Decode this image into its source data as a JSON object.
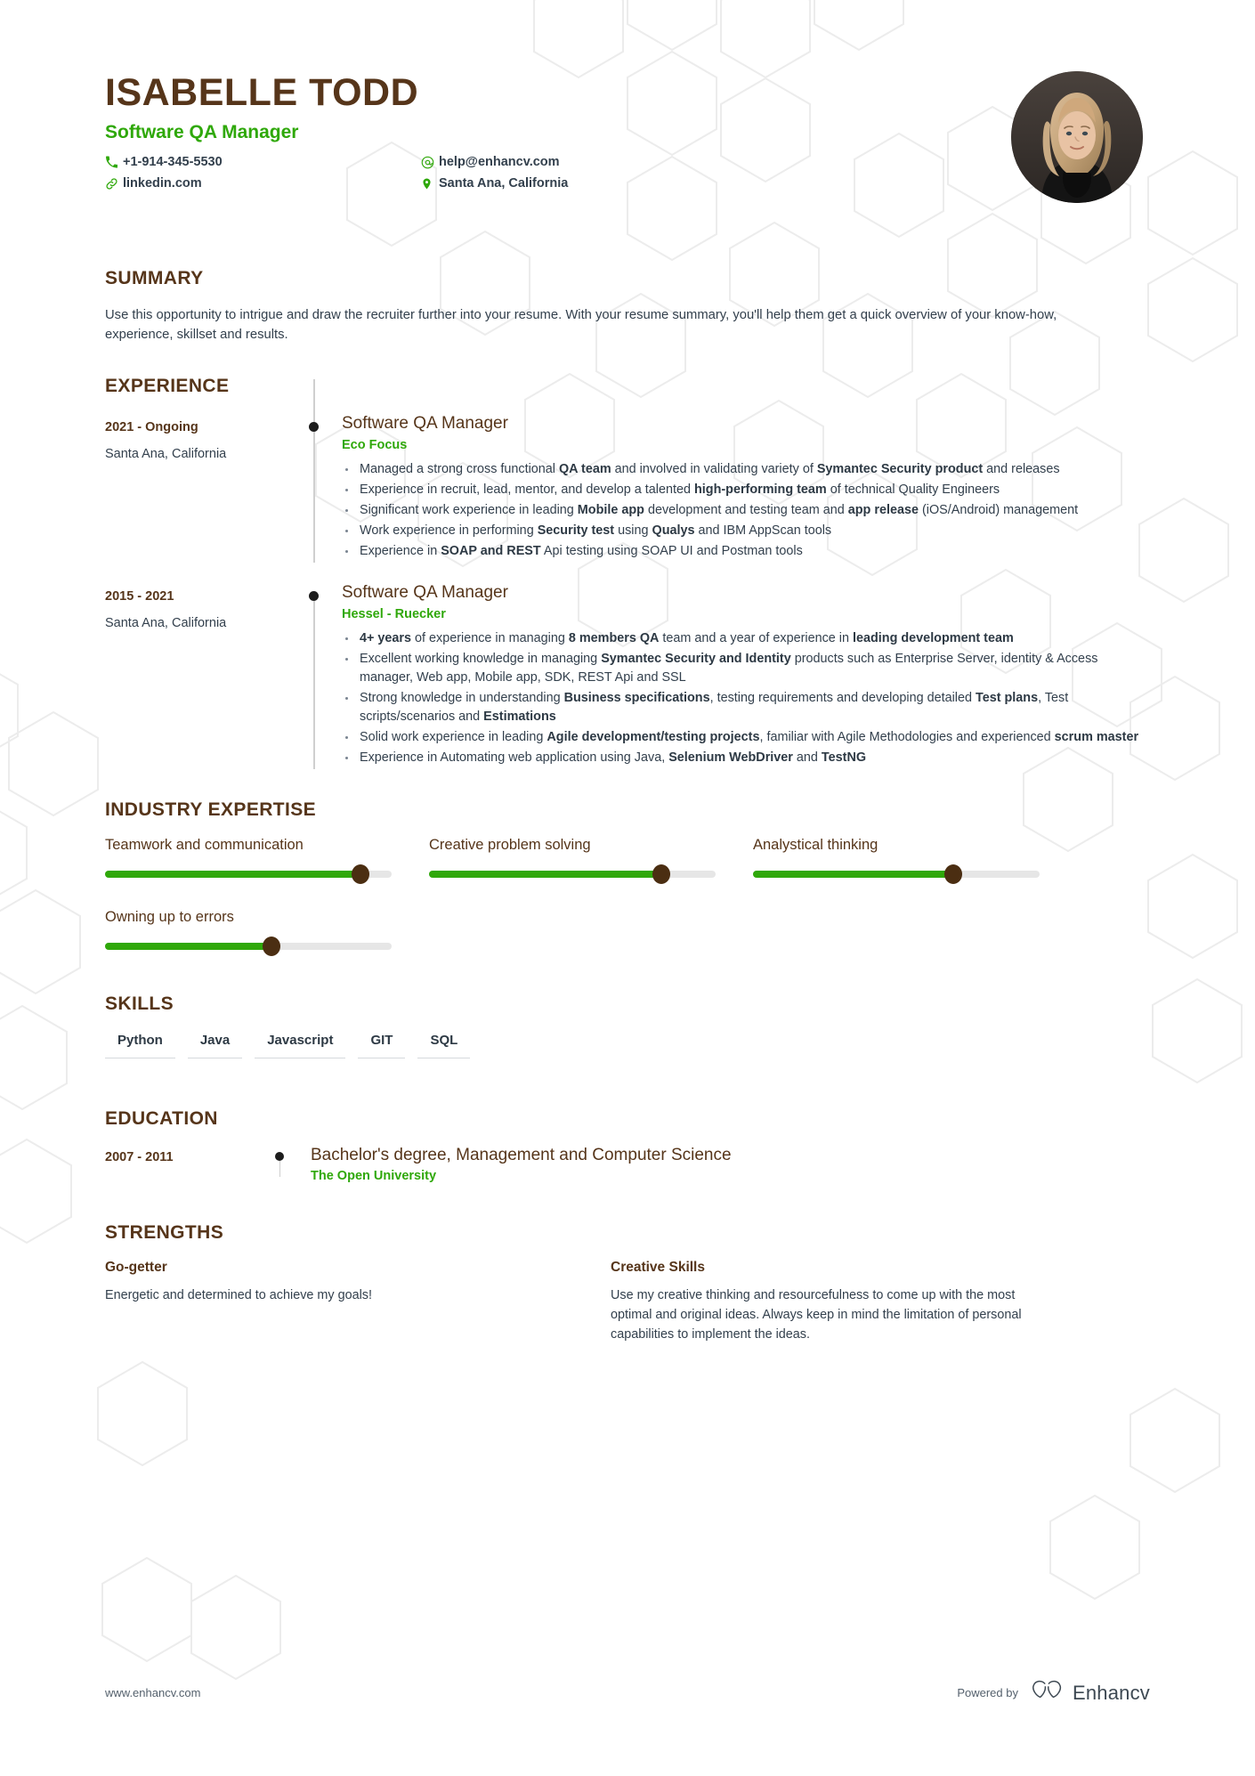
{
  "colors": {
    "heading_brown": "#56351a",
    "accent_green": "#2fa80a",
    "body_text": "#33404d",
    "timeline_dot": "#1d1d1d",
    "slider_track": "#e6e6e6",
    "slider_knob": "#4b2e12"
  },
  "header": {
    "name": "ISABELLE TODD",
    "job_title": "Software QA Manager",
    "contacts": [
      {
        "icon": "phone-icon",
        "text": "+1-914-345-5530"
      },
      {
        "icon": "email-icon",
        "text": "help@enhancv.com"
      },
      {
        "icon": "link-icon",
        "text": "linkedin.com"
      },
      {
        "icon": "location-icon",
        "text": "Santa Ana, California"
      }
    ]
  },
  "summary": {
    "title": "SUMMARY",
    "text": "Use this opportunity to intrigue and draw the recruiter further into your resume. With your resume summary, you'll help them get a quick overview of your know-how, experience, skillset and results."
  },
  "experience": {
    "title": "EXPERIENCE",
    "entries": [
      {
        "date": "2021 - Ongoing",
        "location": "Santa Ana, California",
        "role": "Software QA Manager",
        "company": "Eco Focus",
        "bullets": [
          "Managed a strong cross functional <b>QA team</b> and involved in validating variety of <b>Symantec Security product</b> and releases",
          "Experience in recruit, lead, mentor, and develop a talented <b>high-performing team</b> of technical Quality Engineers",
          "Significant work experience in leading <b>Mobile app</b> development and testing team and <b>app release</b> (iOS/Android) management",
          "Work experience in performing <b>Security test</b> using <b>Qualys</b> and IBM AppScan tools",
          "Experience in <b>SOAP and REST</b> Api testing using SOAP UI and Postman tools"
        ]
      },
      {
        "date": "2015 - 2021",
        "location": "Santa Ana, California",
        "role": "Software QA Manager",
        "company": "Hessel - Ruecker",
        "bullets": [
          "<b>4+ years</b> of experience in managing <b>8 members QA</b> team and a year of experience in <b>leading development team</b>",
          "Excellent working knowledge in managing <b>Symantec Security and Identity</b> products such as Enterprise Server, identity &amp; Access manager, Web app, Mobile app, SDK, REST Api and SSL",
          "Strong knowledge in understanding <b>Business specifications</b>, testing requirements and developing detailed <b>Test plans</b>, Test<br>scripts/scenarios and <b>Estimations</b>",
          "Solid work experience in leading <b>Agile development/testing projects</b>, familiar with Agile Methodologies and experienced <b>scrum master</b>",
          "Experience in Automating web application using Java, <b>Selenium WebDriver</b> and <b>TestNG</b>"
        ]
      }
    ]
  },
  "industry_expertise": {
    "title": "INDUSTRY EXPERTISE",
    "items": [
      {
        "label": "Teamwork and communication",
        "value": 89
      },
      {
        "label": "Creative problem solving",
        "value": 81
      },
      {
        "label": "Analystical thinking",
        "value": 70
      },
      {
        "label": "Owning up to errors",
        "value": 58
      }
    ]
  },
  "skills": {
    "title": "SKILLS",
    "items": [
      "Python",
      "Java",
      "Javascript",
      "GIT",
      "SQL"
    ]
  },
  "education": {
    "title": "EDUCATION",
    "entries": [
      {
        "date": "2007 - 2011",
        "degree": "Bachelor's degree, Management and Computer Science",
        "school": "The Open University"
      }
    ]
  },
  "strengths": {
    "title": "STRENGTHS",
    "items": [
      {
        "title": "Go-getter",
        "text": "Energetic and determined to achieve my goals!"
      },
      {
        "title": "Creative Skills",
        "text": "Use my creative thinking and resourcefulness to come up with the most optimal and original ideas. Always keep in mind the limitation of personal capabilities to implement the ideas."
      }
    ]
  },
  "footer": {
    "url": "www.enhancv.com",
    "powered_by": "Powered by",
    "brand_name": "Enhancv"
  }
}
